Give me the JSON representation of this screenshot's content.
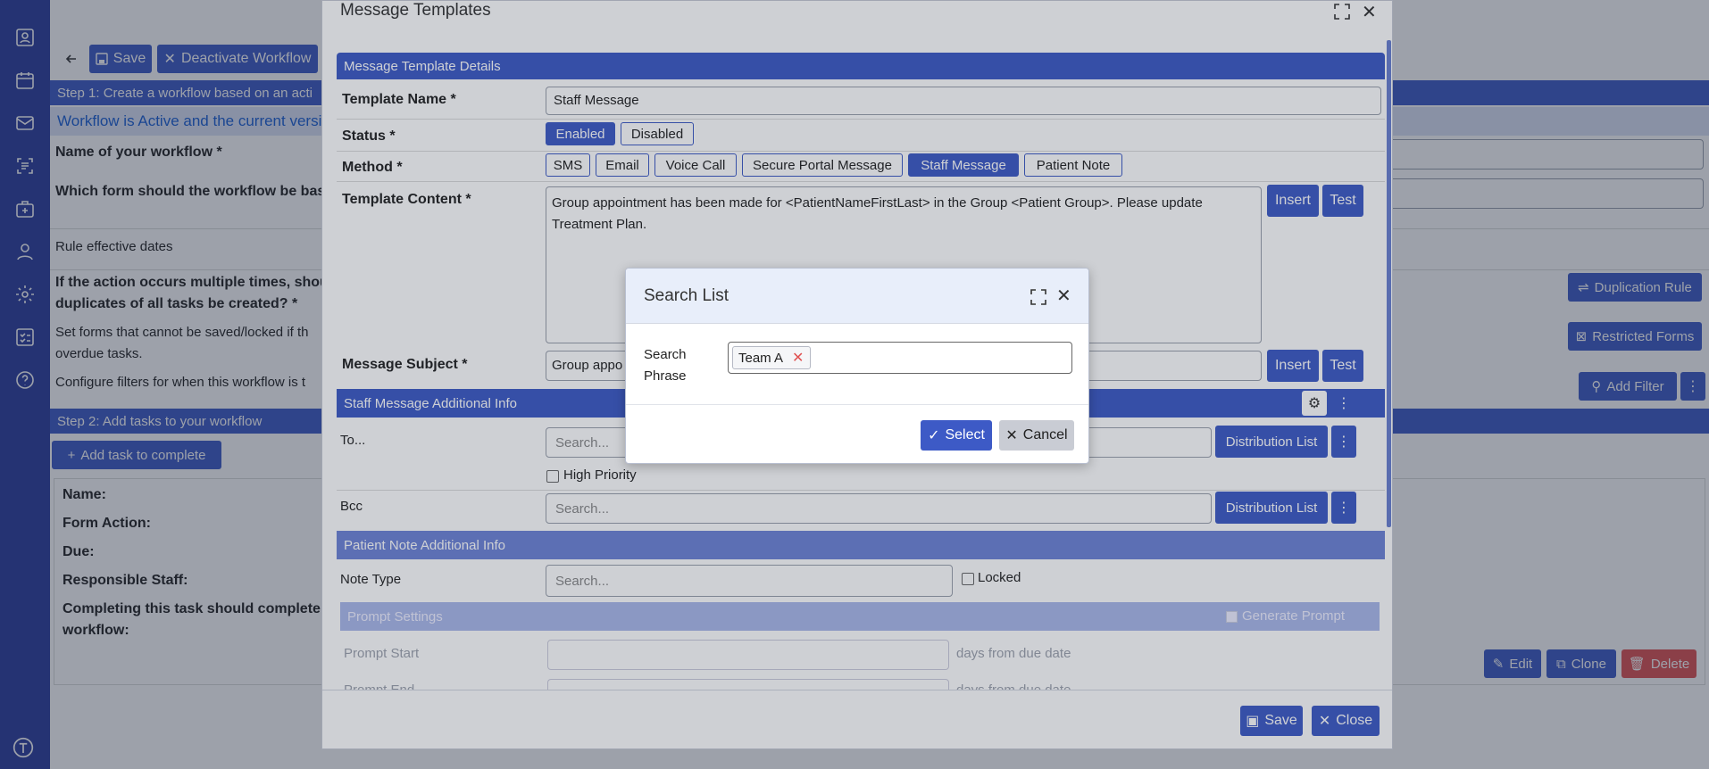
{
  "page": {
    "toolbar": {
      "save": "Save",
      "deactivate": "Deactivate Workflow"
    },
    "step1": "Step 1: Create a workflow based on an acti",
    "active_notice": "Workflow is Active and the current versi",
    "name_q": "Name of your workflow *",
    "form_q": "Which form should the workflow be based",
    "effective_dates": "Rule effective dates",
    "multiple_q1": "If the action occurs multiple times, should",
    "multiple_q2": "duplicates of all tasks be created? *",
    "forms_q1": "Set forms that cannot be saved/locked if th",
    "forms_q2": "overdue tasks.",
    "filters_q": "Configure filters for when this workflow is t",
    "step2": "Step 2: Add tasks to your workflow",
    "add_task": "Add task to complete",
    "task_name": "Name:",
    "task_form_action": "Form Action:",
    "task_due": "Due:",
    "task_staff": "Responsible Staff:",
    "task_complete1": "Completing this task should complete the",
    "task_complete2": "workflow:",
    "duplication_rule": "Duplication Rule",
    "restricted_forms": "Restricted Forms",
    "add_filter": "Add Filter",
    "edit": "Edit",
    "clone": "Clone",
    "delete": "Delete"
  },
  "mt": {
    "title": "Message Templates",
    "details_header": "Message Template Details",
    "template_name_label": "Template Name *",
    "template_name_value": "Staff Message",
    "status_label": "Status *",
    "status_enabled": "Enabled",
    "status_disabled": "Disabled",
    "method_label": "Method *",
    "methods": [
      "SMS",
      "Email",
      "Voice Call",
      "Secure Portal Message",
      "Staff Message",
      "Patient Note"
    ],
    "content_label": "Template Content *",
    "content_line1": "Group appointment has been made for <PatientNameFirstLast> in the Group <Patient Group>. Please update",
    "content_line2": "Treatment Plan.",
    "insert": "Insert",
    "test": "Test",
    "subject_label": "Message Subject *",
    "subject_value": "Group appo",
    "staff_header": "Staff Message Additional Info",
    "to_label": "To...",
    "search_placeholder": "Search...",
    "distribution_list": "Distribution List",
    "high_priority": "High Priority",
    "bcc_label": "Bcc",
    "patient_header": "Patient Note Additional Info",
    "note_type_label": "Note Type",
    "locked": "Locked",
    "prompt_header": "Prompt Settings",
    "generate_prompt": "Generate Prompt",
    "prompt_start": "Prompt Start",
    "prompt_end": "Prompt End",
    "days_from_due": "days from due date",
    "save": "Save",
    "close": "Close"
  },
  "search_list": {
    "title": "Search List",
    "label_line1": "Search",
    "label_line2": "Phrase",
    "tag": "Team A",
    "select": "Select",
    "cancel": "Cancel"
  },
  "colors": {
    "primary": "#3d5ac6",
    "nav": "#2b3d9f",
    "danger": "#e05252"
  }
}
